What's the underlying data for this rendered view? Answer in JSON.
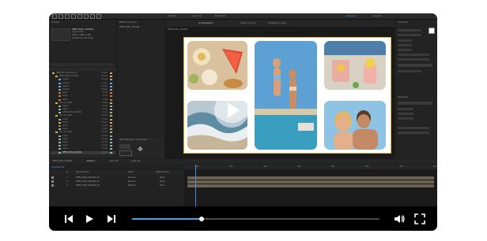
{
  "menubar": {
    "items": [
      "Project",
      "Effect Controls",
      "Composition",
      "Layer",
      "Footage",
      "Essential",
      "Learning",
      "Default",
      "Libraries",
      "Review"
    ],
    "active": "Libraries"
  },
  "project": {
    "tab": "Project",
    "footage_name": "WEB_Edit4_202406_",
    "footage_info": [
      "used 1 time",
      "1920 x 1080 (1.00)",
      "0:00:07:00, 25.00 fps"
    ],
    "list": [
      {
        "name": "WEB_ED_202406_CA",
        "type": "Folder",
        "color": "#d9b43c",
        "level": 0
      },
      {
        "name": "WEB_Edit4_202406",
        "type": "Folder",
        "color": "#d9b43c",
        "level": 1
      },
      {
        "name": "Layer1",
        "type": "Image",
        "color": "#7aa3d6",
        "level": 2
      },
      {
        "name": "Layer2",
        "type": "Image",
        "color": "#7aa3d6",
        "level": 2
      },
      {
        "name": "Layer3",
        "type": "Image",
        "color": "#7aa3d6",
        "level": 2
      },
      {
        "name": "Layer4",
        "type": "Image",
        "color": "#7aa3d6",
        "level": 2
      },
      {
        "name": "Solid",
        "type": "Solid",
        "color": "#c27a3e",
        "level": 2
      },
      {
        "name": "Solid",
        "type": "Solid",
        "color": "#c27a3e",
        "level": 2
      },
      {
        "name": "Solid",
        "type": "Solid",
        "color": "#c27a3e",
        "level": 2
      },
      {
        "name": "Ver_01_2406",
        "type": "Folder",
        "color": "#d9b43c",
        "level": 1
      },
      {
        "name": "Layer",
        "type": "Comp",
        "color": "#8bb7a4",
        "level": 2
      },
      {
        "name": "Layer",
        "type": "Comp",
        "color": "#8bb7a4",
        "level": 2
      },
      {
        "name": "WEB_Edit4_202406",
        "type": "Comp",
        "color": "#8bb7a4",
        "level": 2
      },
      {
        "name": "Ver_02_2406",
        "type": "Folder",
        "color": "#d9b43c",
        "level": 1
      },
      {
        "name": "Layer",
        "type": "Comp",
        "color": "#8bb7a4",
        "level": 2
      },
      {
        "name": "Solids",
        "type": "Folder",
        "color": "#d9b43c",
        "level": 2
      },
      {
        "name": "Solid",
        "type": "Solid",
        "color": "#c27a3e",
        "level": 2
      },
      {
        "name": "Layer",
        "type": "Comp",
        "color": "#8bb7a4",
        "level": 2
      },
      {
        "name": "Ver_03_2406",
        "type": "Folder",
        "color": "#d9b43c",
        "level": 1
      },
      {
        "name": "Layer",
        "type": "Comp",
        "color": "#8bb7a4",
        "level": 2
      },
      {
        "name": "Layer",
        "type": "Comp",
        "color": "#8bb7a4",
        "level": 2
      },
      {
        "name": "Layer",
        "type": "Comp",
        "color": "#8bb7a4",
        "level": 2
      },
      {
        "name": "Layer",
        "type": "Comp",
        "color": "#8bb7a4",
        "level": 2
      },
      {
        "name": "Layer",
        "type": "Comp",
        "color": "#8bb7a4",
        "level": 2
      },
      {
        "name": "WEB_Edit4_202406",
        "type": "Comp",
        "color": "#8bb7a4",
        "level": 2,
        "selected": true
      },
      {
        "name": "Solid",
        "type": "Solid",
        "color": "#c27a3e",
        "level": 2
      }
    ]
  },
  "effects": {
    "tab": "Effect Controls",
    "layer_name": "WEB_Edit4_202406",
    "panel2_title": "Media Browser  Content-Aw"
  },
  "composition": {
    "tabs": [
      "Composition",
      "WEB_Edit4_202406",
      "Layer (none)",
      "Footage (none)"
    ],
    "breadcrumb": "WEB_Edit4_202406",
    "zoom": "Full",
    "timecode": "0:00:00:00"
  },
  "right_panel": {
    "sections": [
      "Character",
      "Paragraph"
    ]
  },
  "timeline": {
    "tabs": [
      "WEB_Edit4_202406",
      "Comp 1",
      "Layer 02",
      "Layer 03"
    ],
    "timecode": "0:00:00:01",
    "header_cols": [
      "#",
      "Source Name",
      "Mode",
      "Parent & Link"
    ],
    "layers": [
      {
        "num": "1",
        "name": "WEB_Edit4_202406_04",
        "mode": "Normal",
        "parent": "None"
      },
      {
        "num": "2",
        "name": "WEB_Edit4_202406_03",
        "mode": "Normal",
        "parent": "None"
      },
      {
        "num": "3",
        "name": "WEB_Edit4_202406_02",
        "mode": "Normal",
        "parent": "None"
      }
    ],
    "ruler": [
      "00s",
      "01s",
      "02s",
      "03s",
      "04s",
      "05s",
      "06s",
      "07s"
    ]
  },
  "player": {
    "progress": 0.28,
    "accent": "#3fa9f5",
    "icons": [
      "skip-back-icon",
      "play-icon",
      "skip-forward-icon",
      "volume-icon",
      "fullscreen-icon"
    ]
  }
}
